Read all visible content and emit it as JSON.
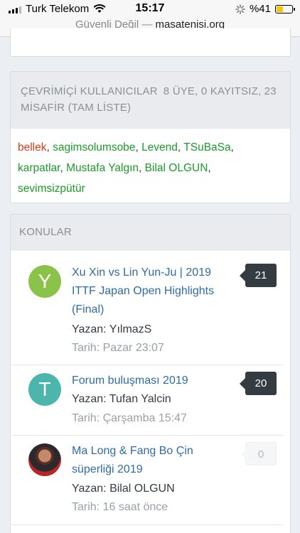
{
  "status_bar": {
    "carrier": "Turk Telekom",
    "time": "15:17",
    "battery_percent": "%41",
    "battery_level": 0.41
  },
  "url_bar": {
    "security_label": "Güvenli Değil —",
    "domain": "masatenisi.org"
  },
  "online_users": {
    "title": "ÇEVRİMİÇİ KULLANICILAR",
    "summary": "8 ÜYE, 0 KAYITSIZ, 23 MİSAFİR (TAM LİSTE)",
    "users": [
      {
        "name": "bellek",
        "color": "#d13b1b"
      },
      {
        "name": "sagimsolumsobe",
        "color": "#1b9b29"
      },
      {
        "name": "Levend",
        "color": "#1b9b29"
      },
      {
        "name": "TSuBaSa",
        "color": "#1b9b29"
      },
      {
        "name": "karpatlar",
        "color": "#1b9b29"
      },
      {
        "name": "Mustafa Yalgın",
        "color": "#1b9b29"
      },
      {
        "name": "Bilal OLGUN",
        "color": "#1b9b29"
      },
      {
        "name": "sevimsizpütür",
        "color": "#1b9b29"
      }
    ]
  },
  "topics": {
    "title": "KONULAR",
    "items": [
      {
        "avatar_letter": "Y",
        "title": "Xu Xin vs Lin Yun-Ju | 2019 ITTF Japan Open Highlights (Final)",
        "author": "Yazan: YılmazS",
        "date": "Tarih: Pazar 23:07",
        "replies": "21"
      },
      {
        "avatar_letter": "T",
        "title": "Forum buluşması 2019",
        "author": "Yazan: Tufan Yalcin",
        "date": "Tarih: Çarşamba 15:47",
        "replies": "20"
      },
      {
        "avatar_letter": "",
        "title": "Ma Long & Fang Bo Çin süperliği 2019",
        "author": "Yazan: Bilal OLGUN",
        "date": "Tarih: 16 saat önce",
        "replies": "0"
      }
    ]
  }
}
